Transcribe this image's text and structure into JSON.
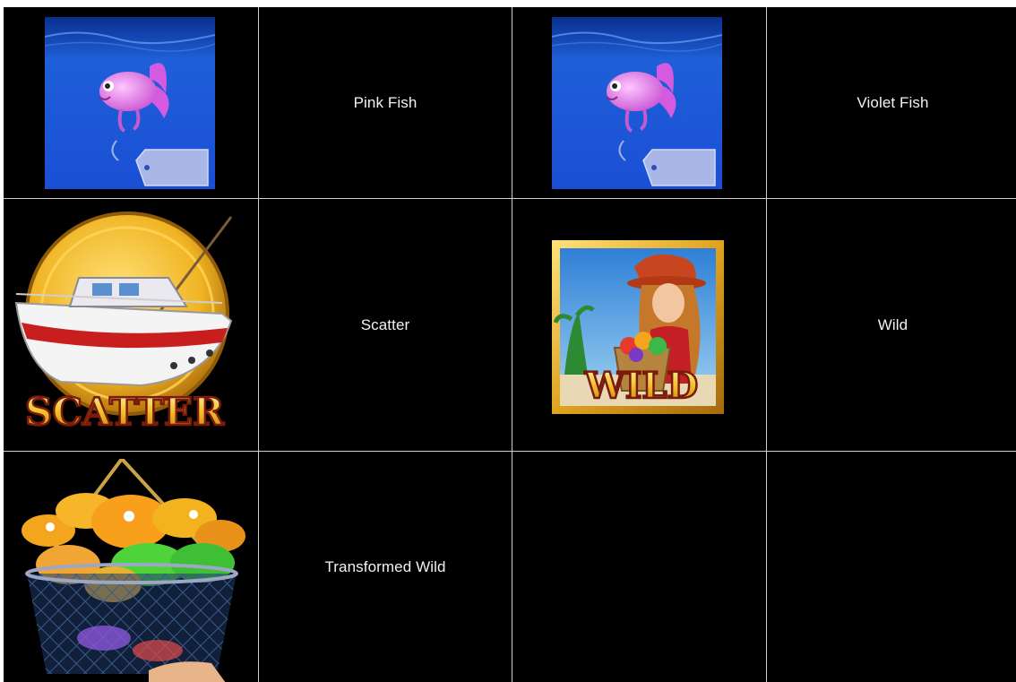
{
  "paytable": {
    "rows": [
      [
        {
          "icon": "pink-fish-symbol-icon",
          "label": "Pink Fish"
        },
        {
          "icon": "violet-fish-symbol-icon",
          "label": "Violet Fish"
        }
      ],
      [
        {
          "icon": "scatter-boat-symbol-icon",
          "label": "Scatter",
          "art_text": "SCATTER"
        },
        {
          "icon": "wild-woman-symbol-icon",
          "label": "Wild",
          "art_text": "WILD"
        }
      ],
      [
        {
          "icon": "fish-basket-symbol-icon",
          "label": "Transformed Wild"
        },
        {
          "icon": "",
          "label": ""
        }
      ]
    ]
  },
  "colors": {
    "background": "#000000",
    "grid_line": "#cfcfcf",
    "text": "#f2f2f2",
    "water_top": "#0a2f8f",
    "water_bottom": "#1e63e8",
    "fish_pink": "#e36ae8",
    "gold": "#e6b230",
    "boat_hull_red": "#c81e1e"
  }
}
